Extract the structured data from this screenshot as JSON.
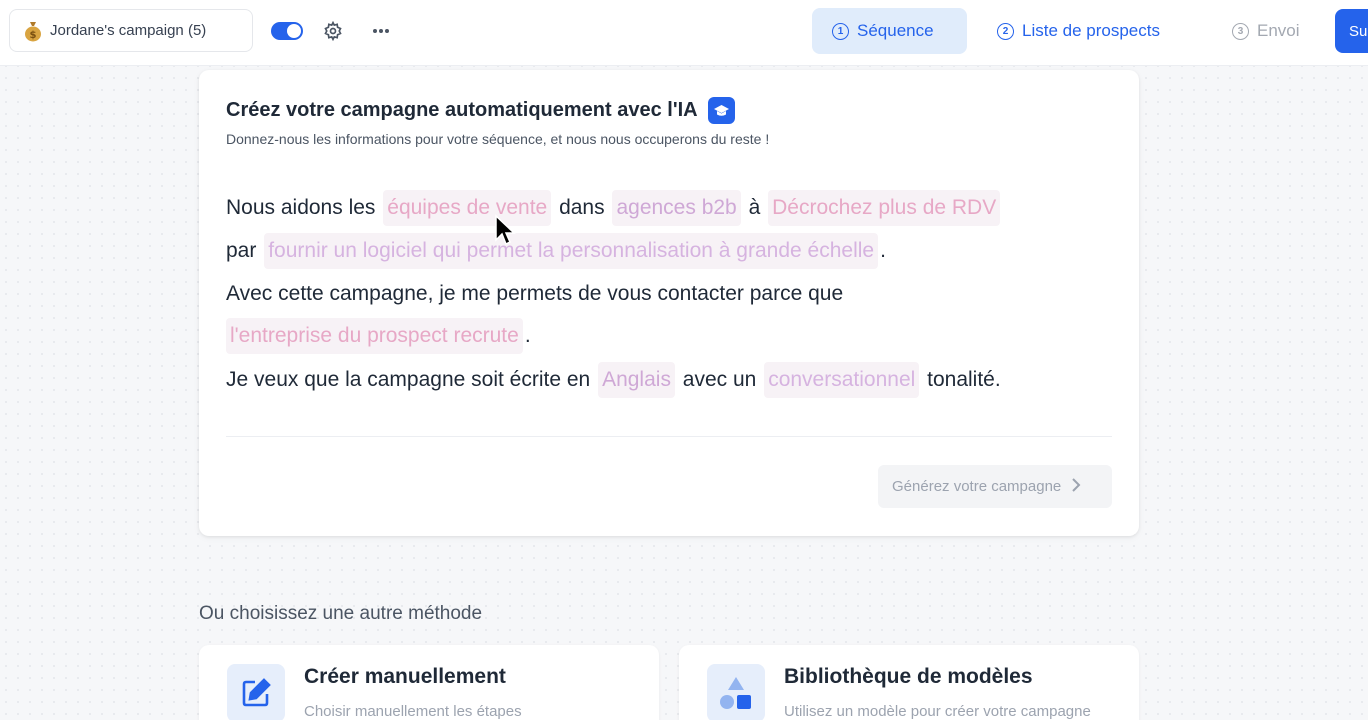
{
  "header": {
    "campaign_name": "Jordane's campaign (5)",
    "steps": [
      {
        "num": "1",
        "label": "Séquence",
        "active": true
      },
      {
        "num": "2",
        "label": "Liste de prospects",
        "active": false
      },
      {
        "num": "3",
        "label": "Envoi",
        "active": false
      }
    ],
    "next_label": "Su"
  },
  "ai_card": {
    "title": "Créez votre campagne automatiquement avec l'IA",
    "subtitle": "Donnez-nous les informations pour votre séquence, et nous nous occuperons du reste !",
    "line1": {
      "t1": "Nous aidons les",
      "target_placeholder": "équipes de vente",
      "t2": "dans",
      "industry_placeholder": "agences b2b",
      "t3": "à",
      "goal_placeholder": "Décrochez plus de RDV"
    },
    "line2": {
      "t1": "par",
      "method_placeholder": "fournir un logiciel qui permet la personnalisation à grande échelle",
      "t2": "."
    },
    "line3": {
      "t1": "Avec cette campagne, je me permets de vous contacter parce que"
    },
    "line4": {
      "reason_placeholder": "l'entreprise du prospect recrute",
      "t1": "."
    },
    "line5": {
      "t1": "Je veux que la campagne soit écrite en",
      "language_placeholder": "Anglais",
      "t2": "avec un",
      "tone_placeholder": "conversationnel",
      "t3": "tonalité."
    },
    "generate_label": "Générez votre campagne"
  },
  "alternatives": {
    "title": "Ou choisissez une autre méthode",
    "methods": [
      {
        "title": "Créer manuellement",
        "desc": "Choisir manuellement les étapes"
      },
      {
        "title": "Bibliothèque de modèles",
        "desc": "Utilisez un modèle pour créer votre campagne"
      }
    ]
  },
  "colors": {
    "accent": "#2563eb",
    "placeholder_pink": "#e7a8c6",
    "chip_bg": "#f7f2f6"
  }
}
